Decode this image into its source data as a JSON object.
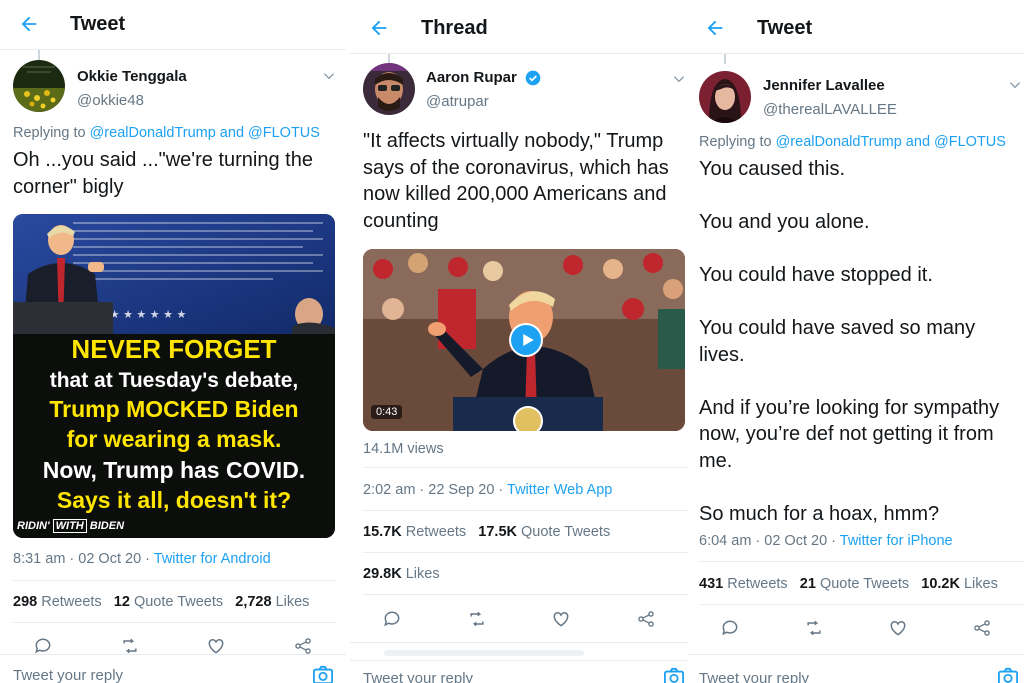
{
  "colors": {
    "accent": "#1da1f2",
    "secondary": "#657786",
    "text": "#14171a",
    "poster_yellow": "#ffe500"
  },
  "panel1": {
    "title": "Tweet",
    "author": {
      "name": "Okkie Tenggala",
      "handle": "@okkie48"
    },
    "replying_prefix": "Replying to ",
    "replying_to_1": "@realDonaldTrump",
    "replying_and": " and ",
    "replying_to_2": "@FLOTUS",
    "text": "Oh ...you said ...\"we're turning the\ncorner\" bigly",
    "poster": {
      "line1": "NEVER FORGET",
      "line2": "that at Tuesday's debate,",
      "line3": "Trump MOCKED Biden",
      "line4": "for wearing a mask.",
      "line5": "Now, Trump has COVID.",
      "line6": "Says it all, doesn't it?",
      "badge_a": "RIDIN'",
      "badge_b": "WITH",
      "badge_c": "BIDEN"
    },
    "time": "8:31 am · 02 Oct 20 · ",
    "source": "Twitter for Android",
    "retweets": "298",
    "retweets_label": " Retweets",
    "quotes": "12",
    "quotes_label": " Quote Tweets",
    "likes": "2,728",
    "likes_label": " Likes",
    "reply_placeholder": "Tweet your reply"
  },
  "panel2": {
    "title": "Thread",
    "author": {
      "name": "Aaron Rupar",
      "handle": "@atrupar",
      "verified": true
    },
    "text": "\"It affects virtually nobody,\" Trump\nsays of the coronavirus, which has\nnow killed 200,000 Americans and\ncounting",
    "video_duration": "0:43",
    "views": "14.1M views",
    "time": "2:02 am · 22 Sep 20 · ",
    "source": "Twitter Web App",
    "retweets": "15.7K",
    "retweets_label": " Retweets",
    "quotes": "17.5K",
    "quotes_label": " Quote Tweets",
    "likes": "29.8K",
    "likes_label": " Likes",
    "reply_placeholder": "Tweet your reply"
  },
  "panel3": {
    "title": "Tweet",
    "author": {
      "name": "Jennifer Lavallee",
      "handle": "@therealLAVALLEE"
    },
    "replying_prefix": "Replying to ",
    "replying_to_1": "@realDonaldTrump",
    "replying_and": " and ",
    "replying_to_2": "@FLOTUS",
    "text": "You caused this.\n\nYou and you alone.\n\nYou could have stopped it.\n\nYou could have saved so many\nlives.\n\nAnd if you’re looking for sympathy\nnow, you’re def not getting it from\nme.\n\nSo much for a hoax, hmm?",
    "time": "6:04 am · 02 Oct 20 · ",
    "source": "Twitter for iPhone",
    "retweets": "431",
    "retweets_label": " Retweets",
    "quotes": "21",
    "quotes_label": " Quote Tweets",
    "likes": "10.2K",
    "likes_label": " Likes",
    "reply_placeholder": "Tweet your reply"
  }
}
